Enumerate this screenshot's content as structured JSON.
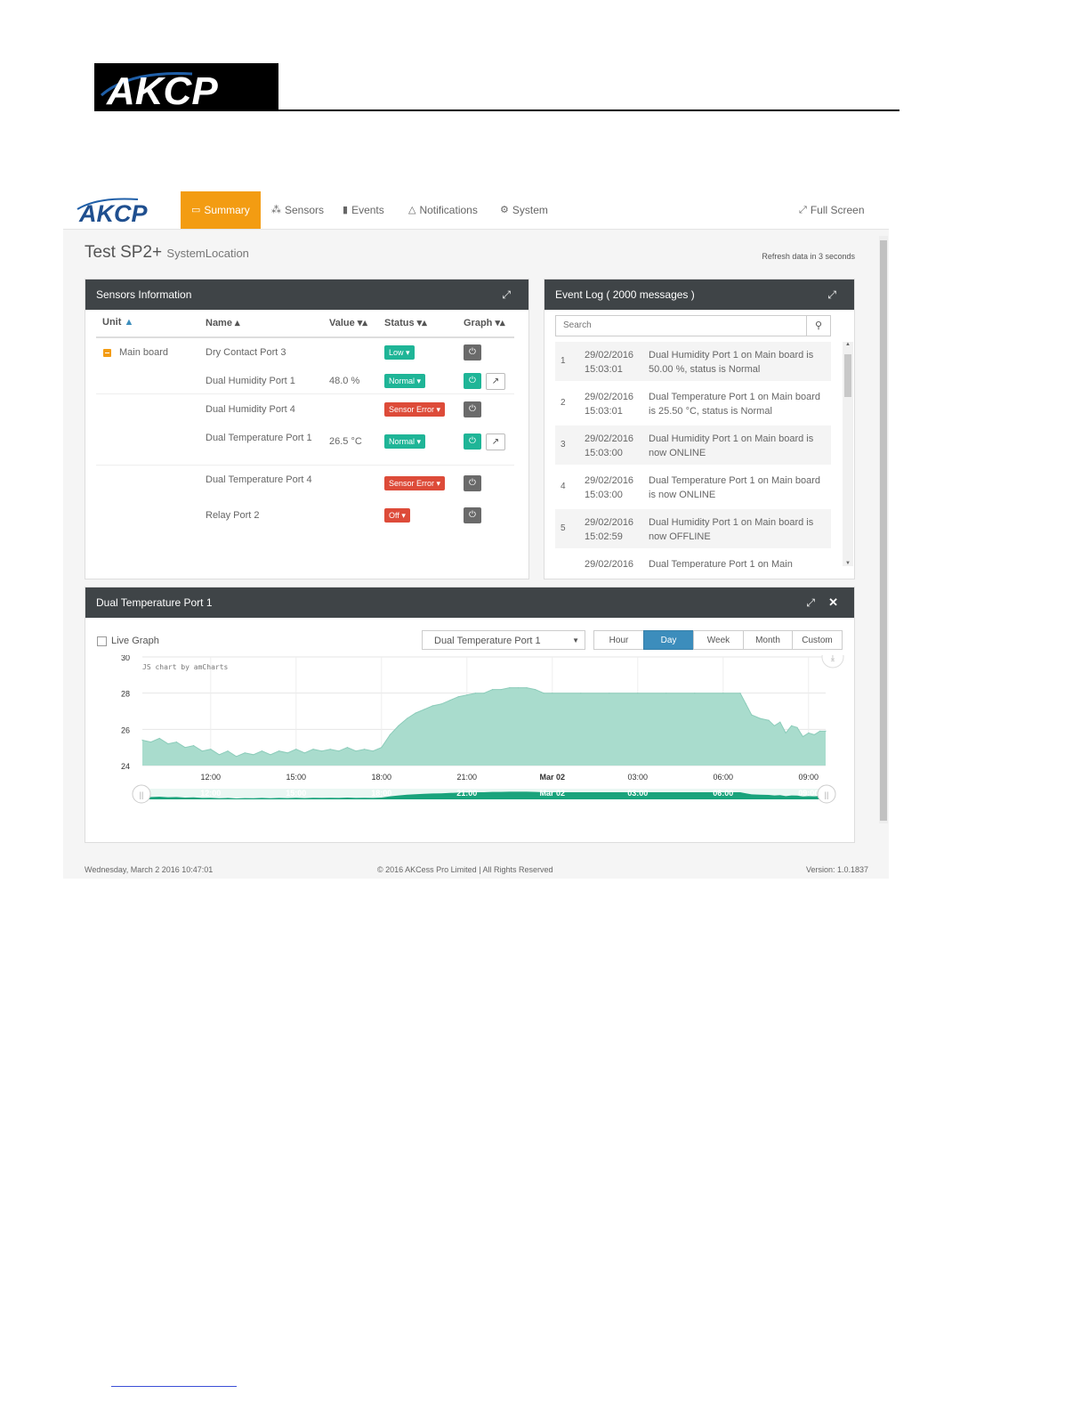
{
  "doc": {
    "logo_text": "AKCP"
  },
  "nav": {
    "brand": "AKCP",
    "items": [
      {
        "label": "Summary",
        "icon": "monitor-icon"
      },
      {
        "label": "Sensors",
        "icon": "rss-icon"
      },
      {
        "label": "Events",
        "icon": "book-icon"
      },
      {
        "label": "Notifications",
        "icon": "bell-icon"
      },
      {
        "label": "System",
        "icon": "gears-icon"
      }
    ],
    "fullscreen": "Full Screen"
  },
  "page": {
    "title": "Test SP2+",
    "location": "SystemLocation",
    "refresh": "Refresh data in 3 seconds"
  },
  "sensors_panel": {
    "title": "Sensors Information",
    "columns": [
      "Unit",
      "Name",
      "Value",
      "Status",
      "Graph"
    ],
    "unit": "Main board",
    "rows": [
      {
        "name": "Dry Contact Port 3",
        "value": "",
        "status": "Low",
        "status_color": "#1fb597",
        "has_graph": false,
        "power_color": "#6a6a6a"
      },
      {
        "name": "Dual Humidity Port 1",
        "value": "48.0 %",
        "status": "Normal",
        "status_color": "#1fb597",
        "has_graph": true,
        "power_color": "#1fb597"
      },
      {
        "name": "Dual Humidity Port 4",
        "value": "",
        "status": "Sensor Error",
        "status_color": "#dd4b39",
        "has_graph": false,
        "power_color": "#6a6a6a"
      },
      {
        "name": "Dual Temperature Port 1",
        "value": "26.5 °C",
        "status": "Normal",
        "status_color": "#1fb597",
        "has_graph": true,
        "power_color": "#1fb597"
      },
      {
        "name": "Dual Temperature Port 4",
        "value": "",
        "status": "Sensor Error",
        "status_color": "#dd4b39",
        "has_graph": false,
        "power_color": "#6a6a6a"
      },
      {
        "name": "Relay Port 2",
        "value": "",
        "status": "Off",
        "status_color": "#dd4b39",
        "has_graph": false,
        "power_color": "#6a6a6a"
      }
    ]
  },
  "event_panel": {
    "title": "Event Log ( 2000 messages )",
    "search_placeholder": "Search",
    "items": [
      {
        "num": "1",
        "date": "29/02/2016",
        "time": "15:03:01",
        "msg": "Dual Humidity Port 1 on Main board is 50.00 %, status is Normal"
      },
      {
        "num": "2",
        "date": "29/02/2016",
        "time": "15:03:01",
        "msg": "Dual Temperature Port 1 on Main board is 25.50 °C, status is Normal"
      },
      {
        "num": "3",
        "date": "29/02/2016",
        "time": "15:03:00",
        "msg": "Dual Humidity Port 1 on Main board is now ONLINE"
      },
      {
        "num": "4",
        "date": "29/02/2016",
        "time": "15:03:00",
        "msg": "Dual Temperature Port 1 on Main board is now ONLINE"
      },
      {
        "num": "5",
        "date": "29/02/2016",
        "time": "15:02:59",
        "msg": "Dual Humidity Port 1 on Main board is now OFFLINE"
      },
      {
        "num": "",
        "date": "29/02/2016",
        "time": "",
        "msg": "Dual Temperature Port 1 on Main"
      }
    ]
  },
  "graph_panel": {
    "title": "Dual Temperature Port 1",
    "live_label": "Live Graph",
    "select_value": "Dual Temperature Port 1",
    "ranges": [
      "Hour",
      "Day",
      "Week",
      "Month",
      "Custom"
    ],
    "active_range": "Day",
    "credit": "JS chart by amCharts"
  },
  "chart_data": {
    "type": "area",
    "color": "#a9dccd",
    "line_color": "#8cccba",
    "ylim": [
      24,
      30
    ],
    "yticks": [
      24,
      26,
      28,
      30
    ],
    "xticks": [
      "12:00",
      "15:00",
      "18:00",
      "21:00",
      "Mar 02",
      "03:00",
      "06:00",
      "09:00"
    ],
    "xtick_bold": "Mar 02",
    "x_hours_range": [
      9.6,
      33.6
    ],
    "series": [
      {
        "values": [
          [
            9.6,
            25.4
          ],
          [
            9.9,
            25.3
          ],
          [
            10.2,
            25.5
          ],
          [
            10.5,
            25.2
          ],
          [
            10.8,
            25.3
          ],
          [
            11.1,
            25.0
          ],
          [
            11.4,
            25.1
          ],
          [
            11.7,
            24.8
          ],
          [
            12.0,
            24.9
          ],
          [
            12.3,
            24.6
          ],
          [
            12.6,
            24.8
          ],
          [
            12.9,
            24.5
          ],
          [
            13.2,
            24.7
          ],
          [
            13.5,
            24.6
          ],
          [
            13.8,
            24.8
          ],
          [
            14.1,
            24.6
          ],
          [
            14.4,
            24.8
          ],
          [
            14.7,
            24.7
          ],
          [
            15.0,
            24.9
          ],
          [
            15.3,
            24.7
          ],
          [
            15.6,
            24.9
          ],
          [
            15.9,
            24.8
          ],
          [
            16.2,
            24.9
          ],
          [
            16.5,
            24.8
          ],
          [
            16.8,
            25.0
          ],
          [
            17.1,
            24.8
          ],
          [
            17.4,
            24.9
          ],
          [
            17.7,
            24.8
          ],
          [
            18.0,
            25.0
          ],
          [
            18.3,
            25.7
          ],
          [
            18.6,
            26.2
          ],
          [
            18.9,
            26.6
          ],
          [
            19.2,
            26.9
          ],
          [
            19.5,
            27.1
          ],
          [
            19.8,
            27.3
          ],
          [
            20.1,
            27.4
          ],
          [
            20.4,
            27.6
          ],
          [
            20.7,
            27.8
          ],
          [
            21.0,
            27.9
          ],
          [
            21.3,
            28.0
          ],
          [
            21.6,
            28.0
          ],
          [
            21.9,
            28.2
          ],
          [
            22.2,
            28.2
          ],
          [
            22.5,
            28.3
          ],
          [
            22.8,
            28.3
          ],
          [
            23.1,
            28.3
          ],
          [
            23.4,
            28.2
          ],
          [
            23.7,
            28.0
          ],
          [
            24.0,
            28.0
          ],
          [
            25.0,
            28.0
          ],
          [
            26.0,
            28.0
          ],
          [
            27.0,
            28.0
          ],
          [
            28.0,
            28.0
          ],
          [
            29.0,
            28.0
          ],
          [
            30.0,
            28.0
          ],
          [
            30.6,
            28.0
          ],
          [
            30.8,
            27.4
          ],
          [
            31.0,
            26.8
          ],
          [
            31.3,
            26.6
          ],
          [
            31.6,
            26.5
          ],
          [
            31.8,
            26.2
          ],
          [
            32.0,
            26.4
          ],
          [
            32.2,
            25.8
          ],
          [
            32.4,
            26.2
          ],
          [
            32.6,
            26.1
          ],
          [
            32.8,
            25.6
          ],
          [
            33.0,
            25.8
          ],
          [
            33.2,
            25.7
          ],
          [
            33.4,
            25.9
          ],
          [
            33.6,
            25.9
          ]
        ]
      }
    ]
  },
  "footer": {
    "datetime": "Wednesday, March 2 2016 10:47:01",
    "copyright": "© 2016 AKCess Pro Limited | All Rights Reserved",
    "version": "Version: 1.0.1837"
  }
}
